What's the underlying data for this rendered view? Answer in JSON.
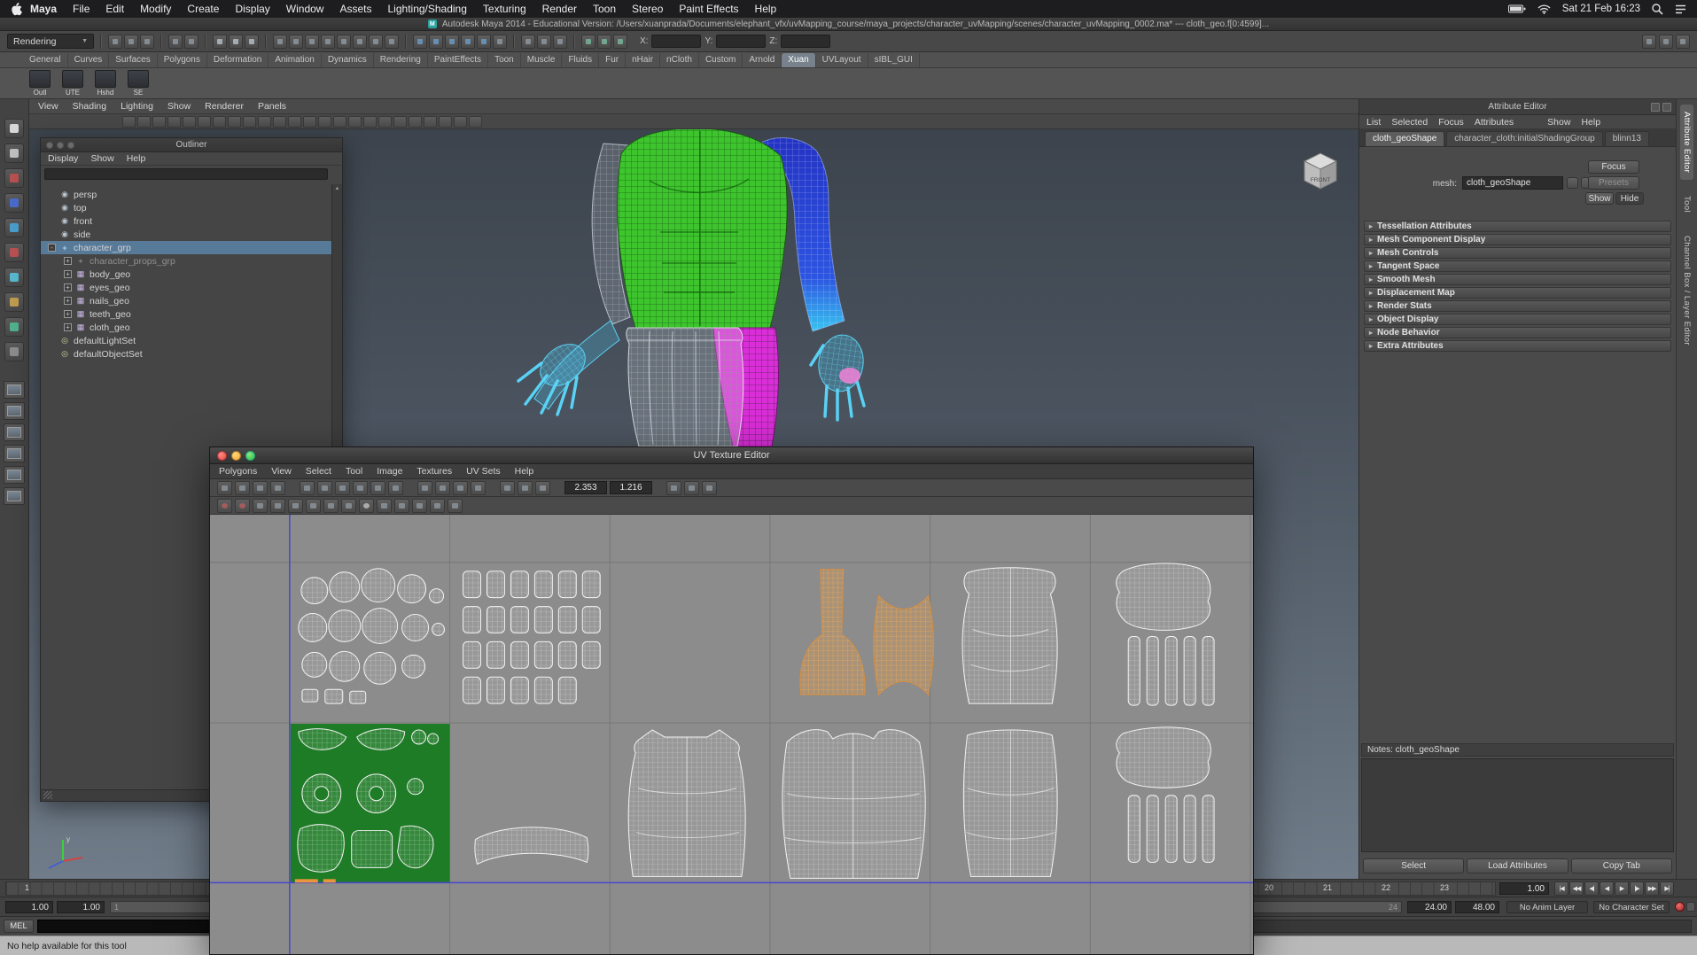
{
  "macos_menubar": {
    "menus": [
      "Maya",
      "File",
      "Edit",
      "Modify",
      "Create",
      "Display",
      "Window",
      "Assets",
      "Lighting/Shading",
      "Texturing",
      "Render",
      "Toon",
      "Stereo",
      "Paint Effects",
      "Help"
    ],
    "clock": "Sat 21 Feb 16:23"
  },
  "window_title": "Autodesk Maya 2014 - Educational Version: /Users/xuanprada/Documents/elephant_vfx/uvMapping_course/maya_projects/character_uvMapping/scenes/character_uvMapping_0002.ma* --- cloth_geo.f[0:4599]...",
  "status_line": {
    "menuset": "Rendering",
    "icon_groups": [
      {
        "icons": [
          "new-scene-icon",
          "open-scene-icon",
          "save-scene-icon"
        ]
      },
      {
        "icons": [
          "undo-icon",
          "redo-icon"
        ]
      },
      {
        "icons": [
          "select-by-hierarchy-icon",
          "select-by-object-icon",
          "select-by-component-icon"
        ]
      },
      {
        "icons": [
          "select-handles-icon",
          "select-joints-icon",
          "select-curves-icon",
          "select-surfaces-icon",
          "select-deformations-icon",
          "select-dynamics-icon",
          "select-rendering-icon",
          "select-misc-icon"
        ]
      },
      {
        "icons": [
          "snap-to-grid-icon",
          "snap-to-curve-icon",
          "snap-to-point-icon",
          "snap-to-projected-center-icon",
          "snap-to-view-plane-icon",
          "make-live-icon"
        ]
      },
      {
        "icons": [
          "input-connections-icon",
          "output-connections-icon",
          "construction-history-icon"
        ]
      },
      {
        "icons": [
          "render-current-frame-icon",
          "ipr-render-icon",
          "render-settings-icon"
        ]
      }
    ],
    "axis_fields": [
      {
        "label": "X:",
        "value": ""
      },
      {
        "label": "Y:",
        "value": ""
      },
      {
        "label": "Z:",
        "value": ""
      }
    ],
    "right_icons": [
      "show-attribute-editor-icon",
      "show-tool-settings-icon",
      "show-channel-box-icon"
    ]
  },
  "shelf": {
    "tabs": [
      {
        "label": "General"
      },
      {
        "label": "Curves"
      },
      {
        "label": "Surfaces"
      },
      {
        "label": "Polygons"
      },
      {
        "label": "Deformation"
      },
      {
        "label": "Animation"
      },
      {
        "label": "Dynamics"
      },
      {
        "label": "Rendering"
      },
      {
        "label": "PaintEffects"
      },
      {
        "label": "Toon"
      },
      {
        "label": "Muscle"
      },
      {
        "label": "Fluids"
      },
      {
        "label": "Fur"
      },
      {
        "label": "nHair"
      },
      {
        "label": "nCloth"
      },
      {
        "label": "Custom"
      },
      {
        "label": "Arnold"
      },
      {
        "label": "Xuan",
        "active": true
      },
      {
        "label": "UVLayout"
      },
      {
        "label": "sIBL_GUI"
      }
    ],
    "items": [
      {
        "label": "Outl"
      },
      {
        "label": "UTE"
      },
      {
        "label": "Hshd"
      },
      {
        "label": "SE"
      }
    ]
  },
  "toolbox": {
    "tools": [
      {
        "n": "select-tool-icon",
        "c": "#e2e2e2"
      },
      {
        "n": "lasso-select-tool-icon",
        "c": "#c8c8c8"
      },
      {
        "n": "paint-select-tool-icon",
        "c": "#c05050"
      },
      {
        "n": "move-tool-icon",
        "c": "#4a6cd4"
      },
      {
        "n": "rotate-tool-icon",
        "c": "#4aa4d4"
      },
      {
        "n": "scale-tool-icon",
        "c": "#c05050"
      },
      {
        "n": "universal-manipulator-icon",
        "c": "#58c0d8"
      },
      {
        "n": "soft-modification-icon",
        "c": "#c8a050"
      },
      {
        "n": "show-manipulator-icon",
        "c": "#50b890"
      },
      {
        "n": "last-tool-icon",
        "c": "#909090"
      }
    ],
    "layouts": [
      "single-pane-layout-icon",
      "two-panes-side-by-side-icon",
      "two-panes-stacked-icon",
      "three-panes-split-icon",
      "four-panes-layout-icon",
      "outliner-persp-layout-icon"
    ]
  },
  "panel_bar": {
    "menus": [
      "View",
      "Shading",
      "Lighting",
      "Show",
      "Renderer",
      "Panels"
    ],
    "icons": [
      "select-camera-icon",
      "lock-camera-icon",
      "camera-attributes-icon",
      "bookmark-view-icon",
      "image-plane-icon",
      "two-d-pan-zoom-icon",
      "grease-pencil-icon",
      "grid-toggle-icon",
      "film-gate-icon",
      "resolution-gate-icon",
      "gate-mask-icon",
      "field-chart-icon",
      "safe-action-icon",
      "safe-title-icon",
      "wireframe-mode-icon",
      "shaded-mode-icon",
      "textured-mode-icon",
      "use-all-lights-icon",
      "shadows-toggle-icon",
      "ambient-occlusion-icon",
      "motion-blur-icon",
      "multisample-aa-icon",
      "depth-of-field-icon",
      "isolate-select-icon"
    ]
  },
  "outliner": {
    "title": "Outliner",
    "menus": [
      "Display",
      "Show",
      "Help"
    ],
    "items": [
      {
        "label": "persp",
        "icon": "camera-icon",
        "indent": 1
      },
      {
        "label": "top",
        "icon": "camera-icon",
        "indent": 1
      },
      {
        "label": "front",
        "icon": "camera-icon",
        "indent": 1
      },
      {
        "label": "side",
        "icon": "camera-icon",
        "indent": 1
      },
      {
        "label": "character_grp",
        "icon": "transform-icon",
        "indent": 1,
        "expander": "open",
        "selected": true
      },
      {
        "label": "character_props_grp",
        "icon": "group-icon",
        "indent": 2,
        "expander": "closed",
        "grayed": true
      },
      {
        "label": "body_geo",
        "icon": "mesh-icon",
        "indent": 2,
        "expander": "closed"
      },
      {
        "label": "eyes_geo",
        "icon": "mesh-icon",
        "indent": 2,
        "expander": "closed"
      },
      {
        "label": "nails_geo",
        "icon": "mesh-icon",
        "indent": 2,
        "expander": "closed"
      },
      {
        "label": "teeth_geo",
        "icon": "mesh-icon",
        "indent": 2,
        "expander": "closed"
      },
      {
        "label": "cloth_geo",
        "icon": "mesh-icon",
        "indent": 2,
        "expander": "closed"
      },
      {
        "label": "defaultLightSet",
        "icon": "set-icon",
        "indent": 1
      },
      {
        "label": "defaultObjectSet",
        "icon": "set-icon",
        "indent": 1
      }
    ]
  },
  "viewport": {
    "view_cube_front": "FRONT"
  },
  "uv_editor": {
    "title": "UV Texture Editor",
    "menus": [
      "Polygons",
      "View",
      "Select",
      "Tool",
      "Image",
      "Textures",
      "UV Sets",
      "Help"
    ],
    "toolbar_a": [
      "flip-u-icon",
      "flip-v-icon",
      "rotate-uv-ccw-icon",
      "rotate-uv-cw-icon"
    ],
    "toolbar_b": [
      "cut-uv-edges-icon",
      "split-uvs-icon",
      "sew-uv-edges-icon",
      "move-and-sew-icon",
      "layout-uvs-icon",
      "unfold-uvs-icon"
    ],
    "toolbar_c": [
      "align-min-u-icon",
      "align-max-u-icon",
      "align-min-v-icon",
      "align-max-v-icon"
    ],
    "toolbar_d": [
      "isolate-select-toggle-icon",
      "add-to-isolation-icon",
      "remove-from-isolation-icon"
    ],
    "u_value": "2.353",
    "v_value": "1.216",
    "toolbar_e": [
      "refresh-view-icon",
      "uv-snapshot-icon",
      "grid-toggle-icon"
    ],
    "toolbar_row2": [
      "pin-selected-uvs-icon",
      "unpin-all-uvs-icon",
      "copy-uvs-icon",
      "paste-uvs-icon",
      "paste-u-only-icon",
      "paste-v-only-icon",
      "image-display-toggle-icon",
      "filtered-image-icon",
      "dim-image-icon",
      "view-image-ratio-icon",
      "pixel-snap-icon",
      "shade-uvs-icon",
      "texture-borders-icon",
      "uv-distortion-icon"
    ]
  },
  "attribute_editor": {
    "title": "Attribute Editor",
    "menus": [
      "List",
      "Selected",
      "Focus",
      "Attributes",
      "Show",
      "Help"
    ],
    "tabs": [
      {
        "label": "cloth_geoShape",
        "active": true
      },
      {
        "label": "character_cloth:initialShadingGroup"
      },
      {
        "label": "blinn13"
      }
    ],
    "mesh_label": "mesh:",
    "mesh_value": "cloth_geoShape",
    "focus_button": "Focus",
    "presets_button": "Presets",
    "show_button": "Show",
    "hide_button": "Hide",
    "sections": [
      "Tessellation Attributes",
      "Mesh Component Display",
      "Mesh Controls",
      "Tangent Space",
      "Smooth Mesh",
      "Displacement Map",
      "Render Stats",
      "Object Display",
      "Node Behavior",
      "Extra Attributes"
    ],
    "notes_label": "Notes: cloth_geoShape",
    "footer_buttons": [
      "Select",
      "Load Attributes",
      "Copy Tab"
    ]
  },
  "right_strip": {
    "tabs": [
      {
        "label": "Attribute Editor",
        "active": true
      },
      {
        "label": "Tool"
      },
      {
        "label": "Channel Box / Layer Editor"
      }
    ]
  },
  "timeline": {
    "start_label": "1",
    "tick_labels": [
      "20",
      "21",
      "22",
      "23"
    ],
    "current_time": "1.00",
    "playback": [
      {
        "n": "go-to-start-icon",
        "g": "|◀"
      },
      {
        "n": "step-back-frame-icon",
        "g": "◀◀"
      },
      {
        "n": "step-back-key-icon",
        "g": "◀|"
      },
      {
        "n": "play-backward-icon",
        "g": "◀"
      },
      {
        "n": "play-forward-icon",
        "g": "▶"
      },
      {
        "n": "step-forward-key-icon",
        "g": "|▶"
      },
      {
        "n": "step-forward-frame-icon",
        "g": "▶▶"
      },
      {
        "n": "go-to-end-icon",
        "g": "▶|"
      }
    ]
  },
  "range_bar": {
    "anim_start": "1.00",
    "play_start": "1.00",
    "slider_start_label": "1",
    "slider_end_label": "24",
    "play_end": "24.00",
    "anim_end": "48.00",
    "anim_layer": "No Anim Layer",
    "character_set": "No Character Set"
  },
  "command_line": {
    "label": "MEL"
  },
  "help_line": {
    "text": "No help available for this tool"
  }
}
